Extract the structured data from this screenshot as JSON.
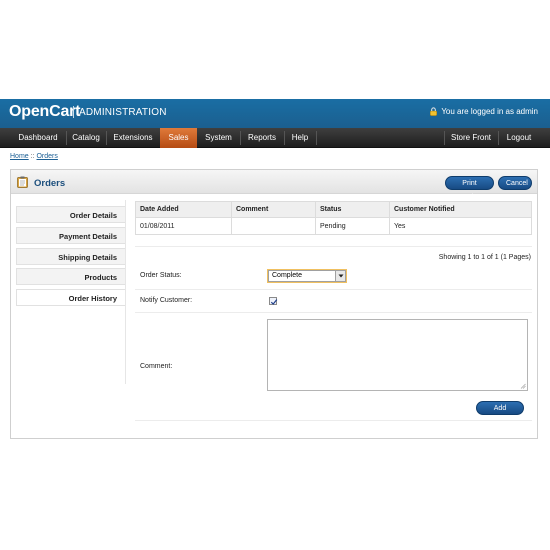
{
  "header": {
    "logo": "OpenCart",
    "section": "ADMINISTRATION",
    "logged_in_text": "You are logged in as admin"
  },
  "nav": {
    "items": [
      "Dashboard",
      "Catalog",
      "Extensions",
      "Sales",
      "System",
      "Reports",
      "Help"
    ],
    "active": "Sales",
    "right_items": [
      "Store Front",
      "Logout"
    ]
  },
  "breadcrumb": {
    "home": "Home",
    "separator": "::",
    "current": "Orders"
  },
  "page": {
    "title": "Orders",
    "print_invoice": "Print Invoice",
    "cancel": "Cancel"
  },
  "tabs": [
    "Order Details",
    "Payment Details",
    "Shipping Details",
    "Products",
    "Order History"
  ],
  "selected_tab": "Order History",
  "history_table": {
    "headers": [
      "Date Added",
      "Comment",
      "Status",
      "Customer Notified"
    ],
    "rows": [
      [
        "01/08/2011",
        "",
        "Pending",
        "Yes"
      ]
    ]
  },
  "pagination_text": "Showing 1 to 1 of 1 (1 Pages)",
  "form": {
    "status_label": "Order Status:",
    "status_value": "Complete",
    "notify_label": "Notify Customer:",
    "notify_checked": true,
    "comment_label": "Comment:",
    "comment_value": "",
    "add_history": "Add History"
  },
  "colors": {
    "header_blue": "#1b6aa0",
    "active_nav": "#c85c1e",
    "button_blue": "#1f5a99",
    "title_blue": "#1c4f7d"
  }
}
